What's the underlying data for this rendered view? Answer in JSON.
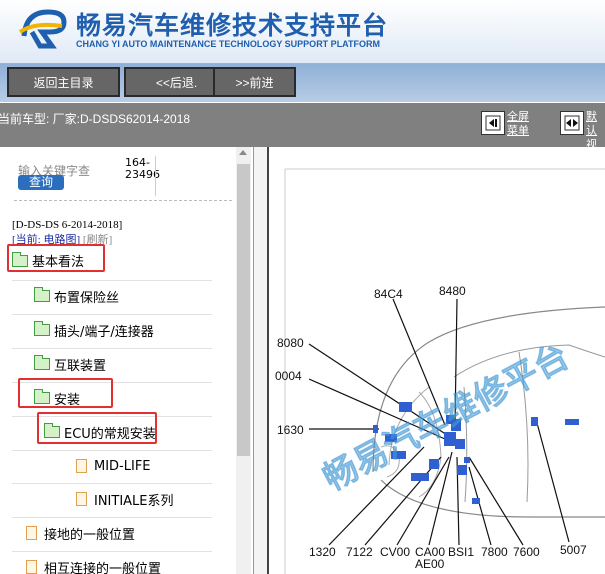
{
  "header": {
    "title": "畅易汽车维修技术支持平台",
    "subtitle": "CHANG YI AUTO MAINTENANCE TECHNOLOGY SUPPORT PLATFORM"
  },
  "toolbar": {
    "home": "返回主目录",
    "back": "<<后退.",
    "forward": ">>前进"
  },
  "infobar": {
    "vehicle": "当前车型:  厂家:D-DSDS62014-2018",
    "fullscreen_1": "全屏",
    "fullscreen_2": "菜单",
    "default_1": "默认",
    "default_2": "视图"
  },
  "sidebar": {
    "search_placeholder": "输入关键字查",
    "search_button": "查询",
    "id_1": "164-",
    "id_2": "23496",
    "model": "[D-DS-DS 6-2014-2018]",
    "current": "[当前:",
    "current_value": "电路图]",
    "refresh": "[刷新]",
    "items": [
      {
        "label": "基本看法"
      },
      {
        "label": "布置保险丝"
      },
      {
        "label": "插头/端子/连接器"
      },
      {
        "label": "互联装置"
      },
      {
        "label": "安装"
      },
      {
        "label": "ECU的常规安装"
      },
      {
        "label": "MID-LIFE"
      },
      {
        "label": "INITIALE系列"
      },
      {
        "label": "接地的一般位置"
      },
      {
        "label": "相互连接的一般位置"
      }
    ]
  },
  "diagram": {
    "watermark": "畅易汽车维修平台",
    "labels": [
      "84C4",
      "8480",
      "8080",
      "0004",
      "1630",
      "1320",
      "7122",
      "CV00",
      "CA00",
      "AE00",
      "BSI1",
      "7800",
      "7600",
      "5007"
    ]
  }
}
